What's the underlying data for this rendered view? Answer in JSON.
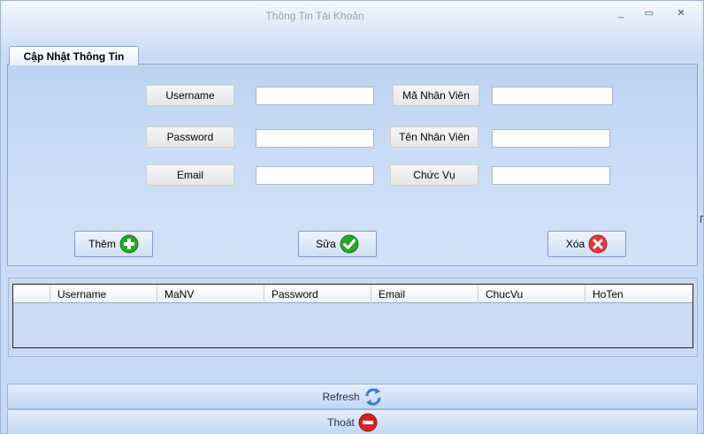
{
  "window": {
    "title": "Thông Tin Tài Khoản",
    "minimize_glyph": "_",
    "maximize_glyph": "▭",
    "close_glyph": "✕"
  },
  "tab": {
    "label": "Cập Nhật Thông Tin"
  },
  "form": {
    "username_label": "Username",
    "password_label": "Password",
    "email_label": "Email",
    "manv_label": "Mã Nhân Viên",
    "tennv_label": "Tên Nhân Viên",
    "chucvu_label": "Chức Vụ",
    "username_value": "",
    "password_value": "",
    "email_value": "",
    "manv_value": "",
    "tennv_value": "",
    "chucvu_value": ""
  },
  "actions": {
    "add_label": "Thêm",
    "add_icon": "plus-circle-icon",
    "edit_label": "Sửa",
    "edit_icon": "check-circle-icon",
    "delete_label": "Xóa",
    "delete_icon": "x-circle-icon"
  },
  "grid": {
    "columns": [
      "Username",
      "MaNV",
      "Password",
      "Email",
      "ChucVu",
      "HoTen"
    ],
    "rows": []
  },
  "bottom": {
    "refresh_label": "Refresh",
    "refresh_icon": "refresh-icon",
    "exit_label": "Thoát",
    "exit_icon": "no-entry-icon"
  },
  "colors": {
    "add": "#2aa52a",
    "edit": "#2aa52a",
    "delete": "#e23a3a",
    "refresh": "#2f7fd8",
    "exit": "#d42323"
  }
}
